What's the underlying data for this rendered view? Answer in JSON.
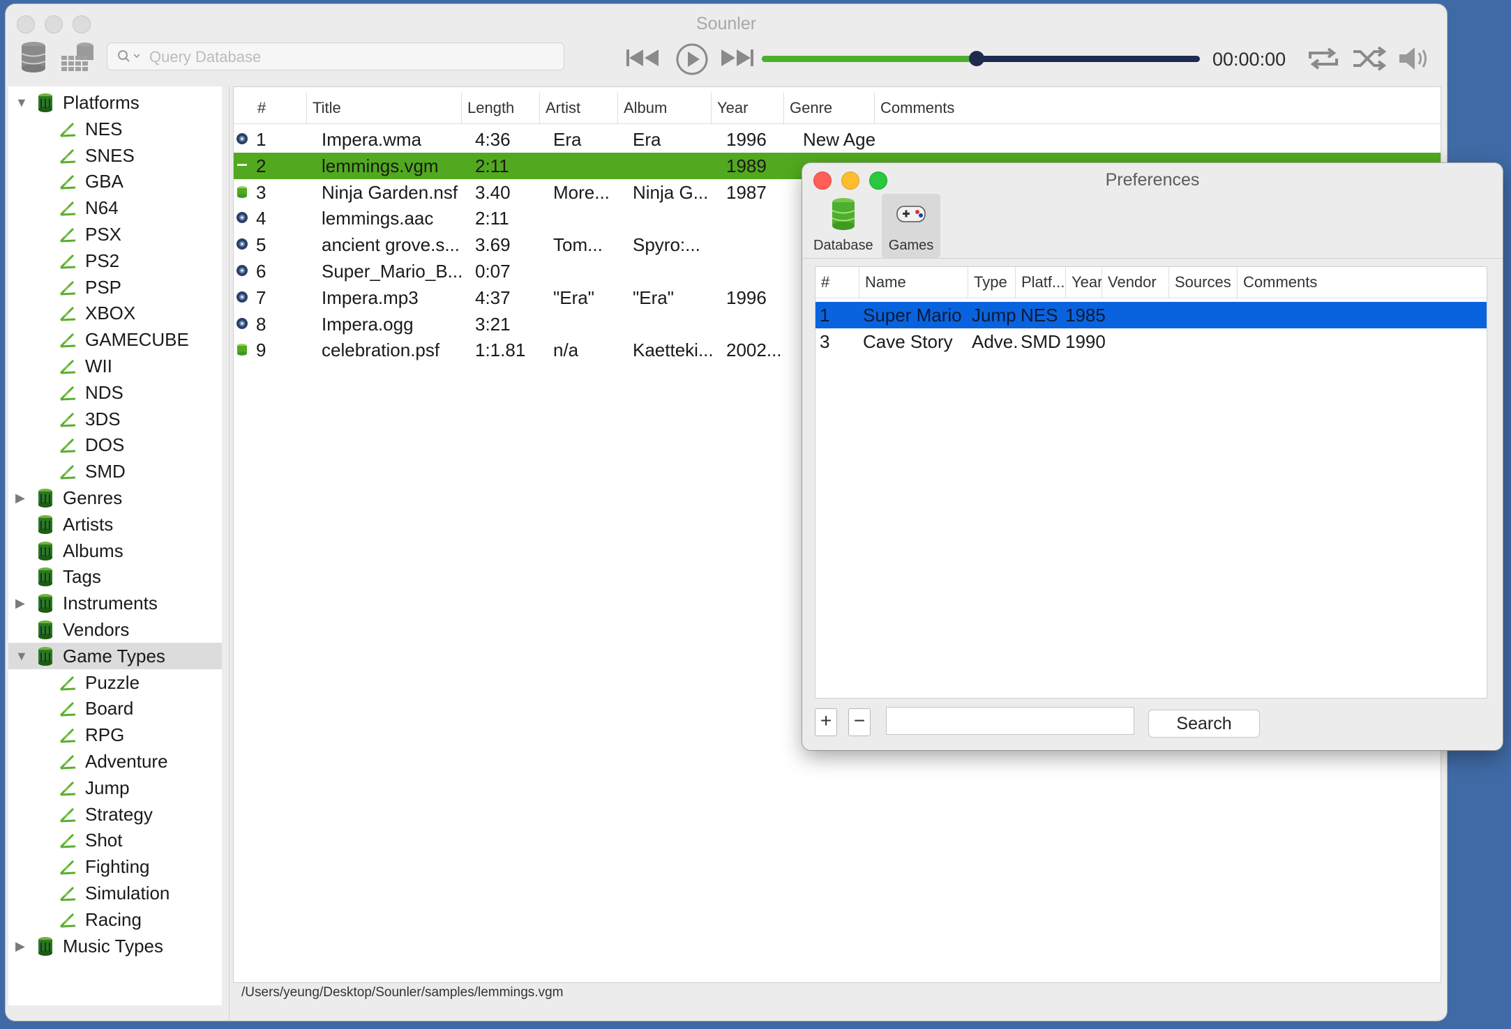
{
  "app": {
    "title": "Sounler",
    "search_placeholder": "Query Database",
    "time": "00:00:00",
    "progress": 0.49
  },
  "sidebar": {
    "items": [
      {
        "label": "Platforms",
        "kind": "category",
        "expanded": true
      },
      {
        "label": "NES",
        "kind": "leaf"
      },
      {
        "label": "SNES",
        "kind": "leaf"
      },
      {
        "label": "GBA",
        "kind": "leaf"
      },
      {
        "label": "N64",
        "kind": "leaf"
      },
      {
        "label": "PSX",
        "kind": "leaf"
      },
      {
        "label": "PS2",
        "kind": "leaf"
      },
      {
        "label": "PSP",
        "kind": "leaf"
      },
      {
        "label": "XBOX",
        "kind": "leaf"
      },
      {
        "label": "GAMECUBE",
        "kind": "leaf"
      },
      {
        "label": "WII",
        "kind": "leaf"
      },
      {
        "label": "NDS",
        "kind": "leaf"
      },
      {
        "label": "3DS",
        "kind": "leaf"
      },
      {
        "label": "DOS",
        "kind": "leaf"
      },
      {
        "label": "SMD",
        "kind": "leaf"
      },
      {
        "label": "Genres",
        "kind": "category",
        "expanded": false
      },
      {
        "label": "Artists",
        "kind": "category"
      },
      {
        "label": "Albums",
        "kind": "category"
      },
      {
        "label": "Tags",
        "kind": "category"
      },
      {
        "label": "Instruments",
        "kind": "category",
        "expanded": false
      },
      {
        "label": "Vendors",
        "kind": "category"
      },
      {
        "label": "Game Types",
        "kind": "category",
        "expanded": true,
        "selected": true
      },
      {
        "label": "Puzzle",
        "kind": "leaf"
      },
      {
        "label": "Board",
        "kind": "leaf"
      },
      {
        "label": "RPG",
        "kind": "leaf"
      },
      {
        "label": "Adventure",
        "kind": "leaf"
      },
      {
        "label": "Jump",
        "kind": "leaf"
      },
      {
        "label": "Strategy",
        "kind": "leaf"
      },
      {
        "label": "Shot",
        "kind": "leaf"
      },
      {
        "label": "Fighting",
        "kind": "leaf"
      },
      {
        "label": "Simulation",
        "kind": "leaf"
      },
      {
        "label": "Racing",
        "kind": "leaf"
      },
      {
        "label": "Music Types",
        "kind": "category",
        "expanded": false
      }
    ]
  },
  "tracks": {
    "columns": [
      "#",
      "Title",
      "Length",
      "Artist",
      "Album",
      "Year",
      "Genre",
      "Comments"
    ],
    "rows": [
      {
        "num": "1",
        "title": "Impera.wma",
        "length": "4:36",
        "artist": "Era",
        "album": "Era",
        "year": "1996",
        "genre": "New Age",
        "icon": "disc-icon"
      },
      {
        "num": "2",
        "title": "lemmings.vgm",
        "length": "2:11",
        "artist": "",
        "album": "",
        "year": "1989",
        "genre": "",
        "icon": "database-icon",
        "playing": true
      },
      {
        "num": "3",
        "title": "Ninja Garden.nsf",
        "length": "3.40",
        "artist": "More...",
        "album": "Ninja G...",
        "year": "1987",
        "genre": "",
        "icon": "database-icon"
      },
      {
        "num": "4",
        "title": "lemmings.aac",
        "length": "2:11",
        "artist": "",
        "album": "",
        "year": "",
        "genre": "",
        "icon": "disc-icon"
      },
      {
        "num": "5",
        "title": "ancient grove.s...",
        "length": "3.69",
        "artist": "Tom...",
        "album": "Spyro:...",
        "year": "",
        "genre": "",
        "icon": "disc-icon"
      },
      {
        "num": "6",
        "title": "Super_Mario_B...",
        "length": "0:07",
        "artist": "",
        "album": "",
        "year": "",
        "genre": "",
        "icon": "disc-icon"
      },
      {
        "num": "7",
        "title": "Impera.mp3",
        "length": "4:37",
        "artist": "\"Era\"",
        "album": "\"Era\"",
        "year": "1996",
        "genre": "",
        "icon": "disc-icon"
      },
      {
        "num": "8",
        "title": "Impera.ogg",
        "length": "3:21",
        "artist": "",
        "album": "",
        "year": "",
        "genre": "",
        "icon": "disc-icon"
      },
      {
        "num": "9",
        "title": "celebration.psf",
        "length": "1:1.81",
        "artist": "n/a",
        "album": "Kaetteki...",
        "year": "2002...",
        "genre": "",
        "icon": "database-icon"
      }
    ]
  },
  "status_path": "/Users/yeung/Desktop/Sounler/samples/lemmings.vgm",
  "prefs": {
    "title": "Preferences",
    "tabs": [
      {
        "label": "Database",
        "icon": "database-icon"
      },
      {
        "label": "Games",
        "icon": "gamepad-icon",
        "active": true
      }
    ],
    "columns": [
      "#",
      "Name",
      "Type",
      "Platf...",
      "Year",
      "Vendor",
      "Sources",
      "Comments"
    ],
    "rows": [
      {
        "num": "1",
        "name": "Super Mario",
        "type": "Jump",
        "platform": "NES",
        "year": "1985",
        "selected": true
      },
      {
        "num": "3",
        "name": "Cave Story",
        "type": "Adve...",
        "platform": "SMD",
        "year": "1990"
      }
    ],
    "search_value": "",
    "search_button": "Search"
  },
  "colors": {
    "accent_green": "#52a91f",
    "selection_blue": "#0a63de",
    "player_navy": "#1f2a4f",
    "desktop": "#3f6aa5"
  }
}
